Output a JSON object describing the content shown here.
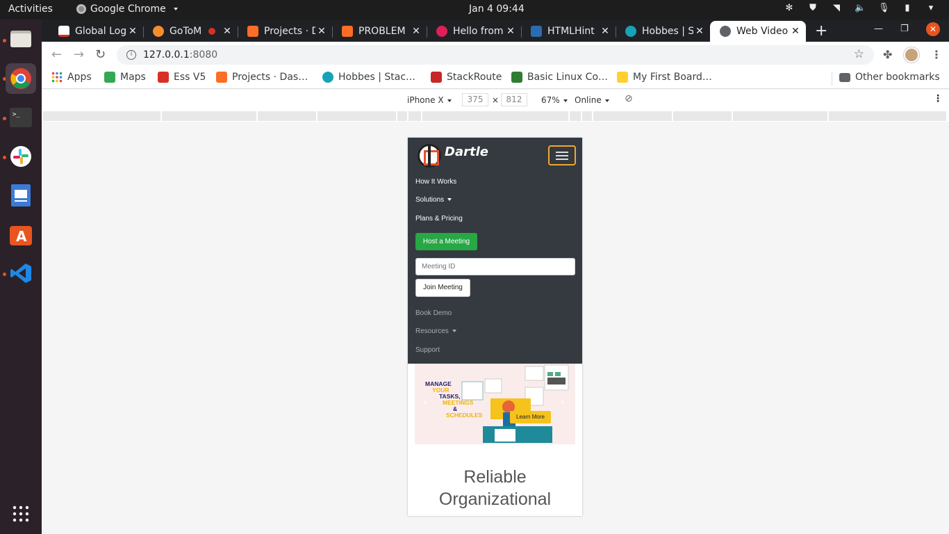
{
  "system": {
    "activities": "Activities",
    "app_name": "Google Chrome",
    "clock": "Jan 4  09:44"
  },
  "browser": {
    "tabs": [
      {
        "label": "Global Log",
        "icon": "gmail-icon"
      },
      {
        "label": "GoToM",
        "icon": "gotomeeting-icon"
      },
      {
        "label": "Projects · D",
        "icon": "gitlab-icon"
      },
      {
        "label": "PROBLEM",
        "icon": "gitlab-icon"
      },
      {
        "label": "Hello from",
        "icon": "slack-icon"
      },
      {
        "label": "HTMLHint",
        "icon": "htmlhint-icon"
      },
      {
        "label": "Hobbes | S",
        "icon": "hobbes-icon"
      },
      {
        "label": "Web Video",
        "icon": "globe-icon",
        "active": true
      }
    ],
    "url_host": "127.0.0.1",
    "url_port": ":8080",
    "bookmarks": [
      {
        "label": "Apps",
        "icon": "apps-grid-icon"
      },
      {
        "label": "Maps",
        "icon": "maps-icon"
      },
      {
        "label": "Ess V5",
        "icon": "ess-icon"
      },
      {
        "label": "Projects · Das…",
        "icon": "gitlab-icon"
      },
      {
        "label": "Hobbes | Stac…",
        "icon": "hobbes-icon"
      },
      {
        "label": "StackRoute",
        "icon": "stackroute-icon"
      },
      {
        "label": "Basic Linux Co…",
        "icon": "robot-icon"
      },
      {
        "label": "My First Board…",
        "icon": "miro-icon"
      }
    ],
    "other_bookmarks": "Other bookmarks"
  },
  "devtools": {
    "device": "iPhone X",
    "width": "375",
    "times": "×",
    "height": "812",
    "zoom": "67%",
    "network": "Online"
  },
  "page": {
    "brand": "Dartle",
    "nav": {
      "how_it_works": "How It Works",
      "solutions": "Solutions",
      "plans": "Plans & Pricing",
      "host_meeting": "Host a Meeting",
      "meeting_id_placeholder": "Meeting ID",
      "join_meeting": "Join Meeting",
      "book_demo": "Book Demo",
      "resources": "Resources",
      "support": "Support"
    },
    "banner": {
      "line1": "MANAGE",
      "line2": "YOUR",
      "line3": "TASKS,",
      "line4": "MEETINGS",
      "line5": "&",
      "line6": "SCHEDULES",
      "learn_more": "Learn More"
    },
    "heading_line1": "Reliable",
    "heading_line2": "Organizational"
  },
  "colors": {
    "nav_bg": "#343a40",
    "host_btn": "#28a745",
    "toggler_border": "#f0a830",
    "learn_more": "#f6c21c",
    "ubuntu_orange": "#e95420"
  }
}
